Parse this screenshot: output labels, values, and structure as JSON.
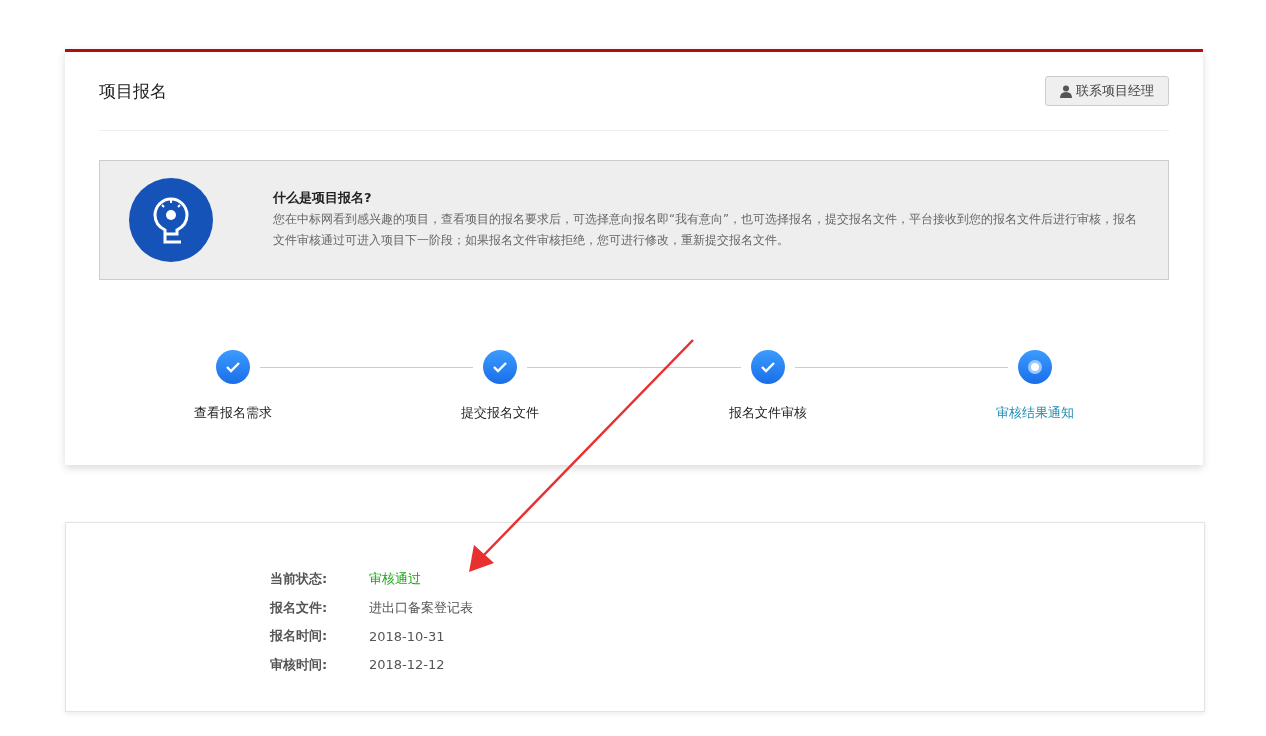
{
  "header": {
    "title": "项目报名",
    "contact_button": "联系项目经理"
  },
  "intro": {
    "heading": "什么是项目报名?",
    "text": "您在中标网看到感兴趣的项目，查看项目的报名要求后，可选择意向报名即“我有意向”，也可选择报名，提交报名文件，平台接收到您的报名文件后进行审核，报名文件审核通过可进入项目下一阶段；如果报名文件审核拒绝，您可进行修改，重新提交报名文件。"
  },
  "steps": [
    {
      "label": "查看报名需求",
      "done": true
    },
    {
      "label": "提交报名文件",
      "done": true
    },
    {
      "label": "报名文件审核",
      "done": true
    },
    {
      "label": "审核结果通知",
      "done": false
    }
  ],
  "details": [
    {
      "label": "当前状态:",
      "value": "审核通过",
      "color": "#19a515"
    },
    {
      "label": "报名文件:",
      "value": "进出口备案登记表",
      "color": "#555555"
    },
    {
      "label": "报名时间:",
      "value": "2018-10-31",
      "color": "#555555"
    },
    {
      "label": "审核时间:",
      "value": "2018-12-12",
      "color": "#555555"
    }
  ]
}
